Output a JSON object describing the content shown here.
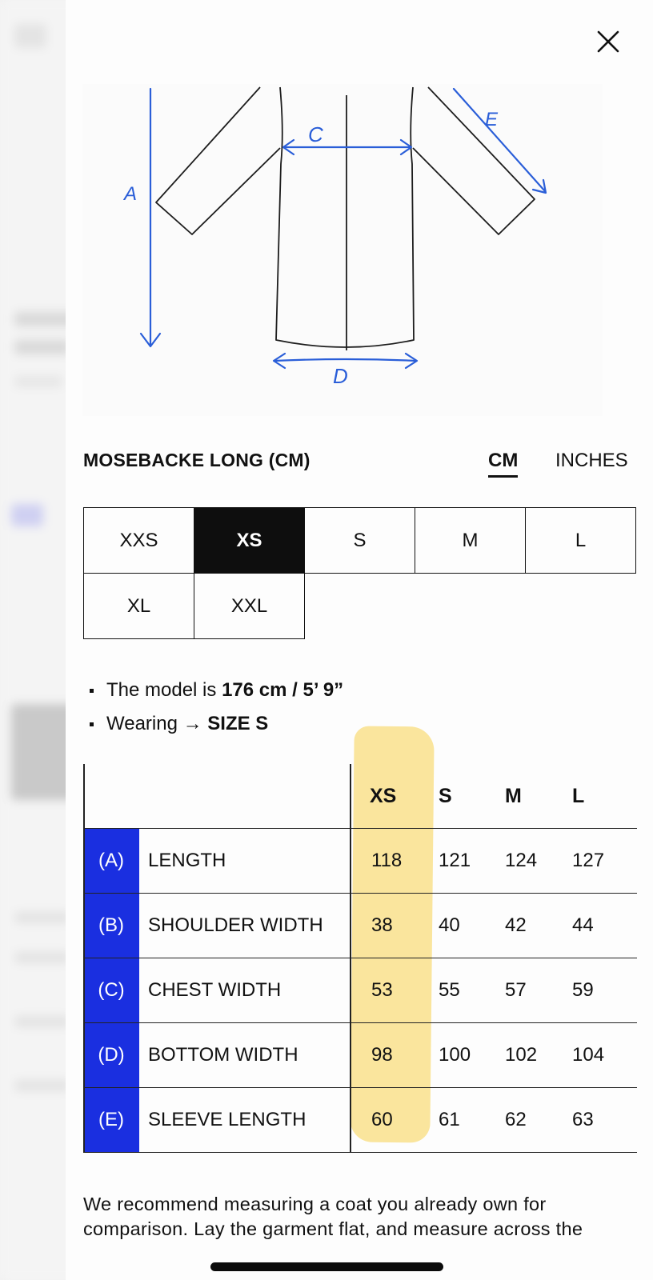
{
  "close_label": "✕",
  "diagram": {
    "labels": {
      "a": "A",
      "c": "C",
      "d": "D",
      "e": "E"
    },
    "accent_color": "#2a5ed8"
  },
  "chart": {
    "title": "MOSEBACKE LONG (CM)",
    "units": {
      "cm": "CM",
      "inches": "INCHES",
      "selected": "CM"
    }
  },
  "sizes": {
    "options": [
      "XXS",
      "XS",
      "S",
      "M",
      "L",
      "XL",
      "XXL"
    ],
    "selected": "XS"
  },
  "model_info": {
    "line1_prefix": "The model is",
    "line1_value": "176 cm / 5’ 9”",
    "line2_prefix": "Wearing →",
    "line2_value": "SIZE S"
  },
  "measurements": {
    "columns": [
      "XS",
      "S",
      "M",
      "L"
    ],
    "rows": [
      {
        "letter": "(A)",
        "name": "LENGTH",
        "values": [
          "118",
          "121",
          "124",
          "127"
        ]
      },
      {
        "letter": "(B)",
        "name": "SHOULDER WIDTH",
        "values": [
          "38",
          "40",
          "42",
          "44"
        ]
      },
      {
        "letter": "(C)",
        "name": "CHEST WIDTH",
        "values": [
          "53",
          "55",
          "57",
          "59"
        ]
      },
      {
        "letter": "(D)",
        "name": "BOTTOM WIDTH",
        "values": [
          "98",
          "100",
          "102",
          "104"
        ]
      },
      {
        "letter": "(E)",
        "name": "SLEEVE LENGTH",
        "values": [
          "60",
          "61",
          "62",
          "63"
        ]
      }
    ],
    "letter_color": "#1a2fe0",
    "highlight_color": "#f8de82"
  },
  "note": "We recommend measuring a coat you already own for comparison. Lay the garment flat, and measure across the"
}
